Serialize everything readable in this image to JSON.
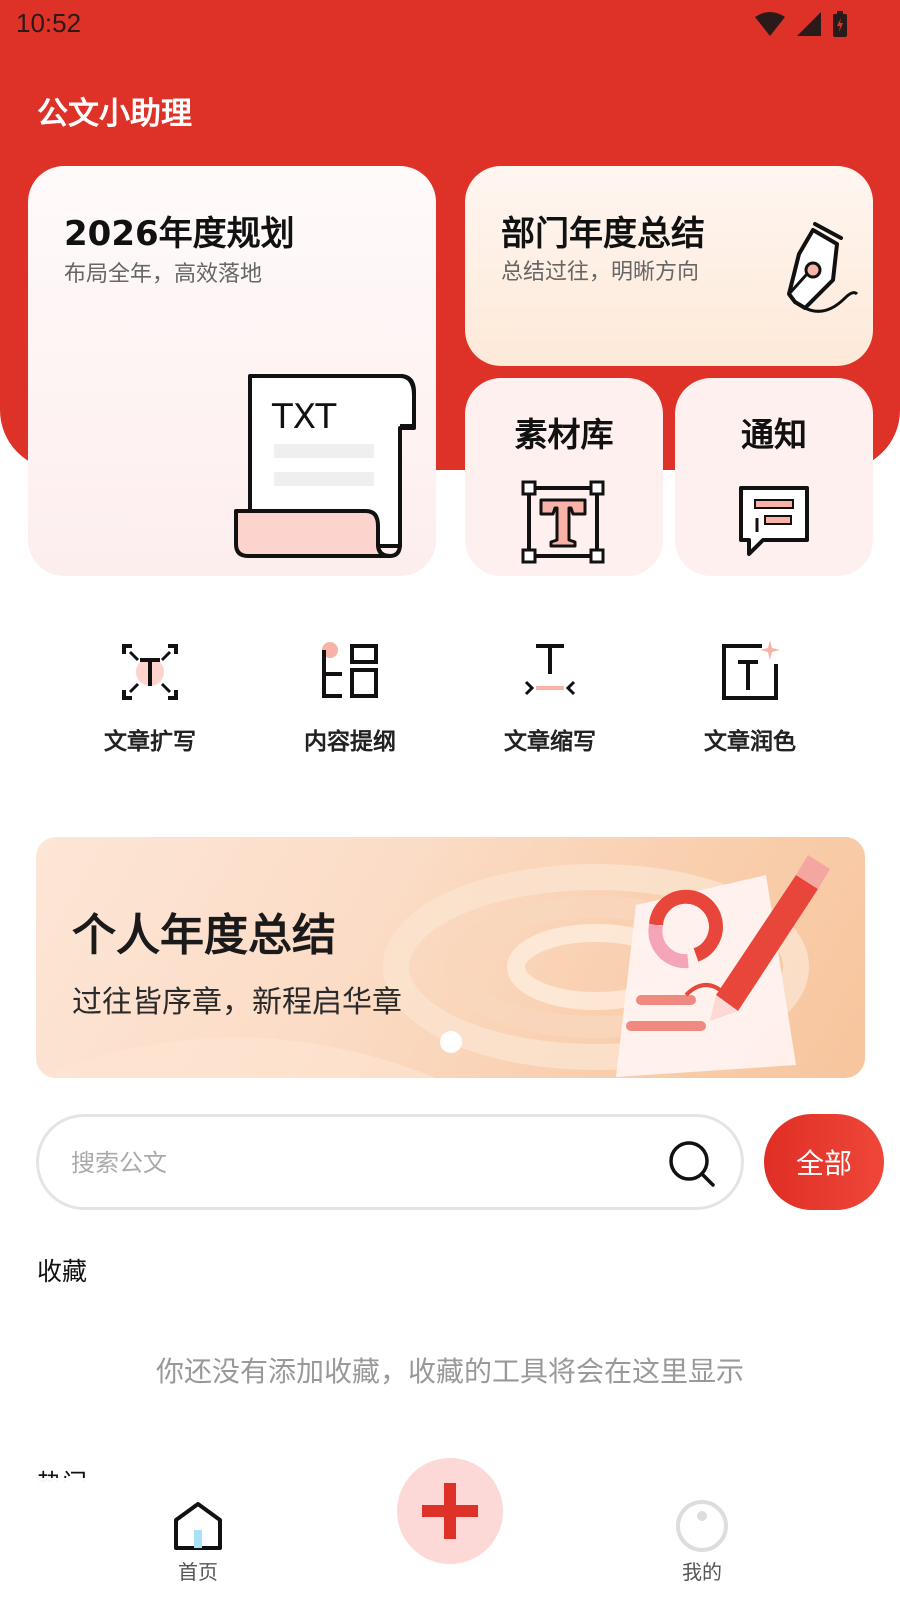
{
  "status_bar": {
    "time": "10:52"
  },
  "app": {
    "title": "公文小助理"
  },
  "cards": {
    "plan": {
      "title": "2026年度规划",
      "subtitle": "布局全年，高效落地",
      "doc_text": "TXT"
    },
    "dept": {
      "title": "部门年度总结",
      "subtitle": "总结过往，明晰方向"
    },
    "materials": {
      "title": "素材库"
    },
    "notice": {
      "title": "通知"
    }
  },
  "tools": [
    {
      "label": "文章扩写",
      "icon": "expand-text-icon"
    },
    {
      "label": "内容提纲",
      "icon": "outline-icon"
    },
    {
      "label": "文章缩写",
      "icon": "condense-text-icon"
    },
    {
      "label": "文章润色",
      "icon": "polish-text-icon"
    }
  ],
  "banner": {
    "title": "个人年度总结",
    "subtitle": "过往皆序章，新程启华章"
  },
  "search": {
    "placeholder": "搜索公文",
    "filter_label": "全部"
  },
  "favorites": {
    "heading": "收藏",
    "empty_text": "你还没有添加收藏，收藏的工具将会在这里显示"
  },
  "hot": {
    "heading": "热门"
  },
  "bottom_nav": {
    "home": "首页",
    "mine": "我的"
  },
  "colors": {
    "brand_red": "#de3127",
    "card_pink": "#fdf0ef",
    "accent_pink": "#fcd9d6"
  }
}
